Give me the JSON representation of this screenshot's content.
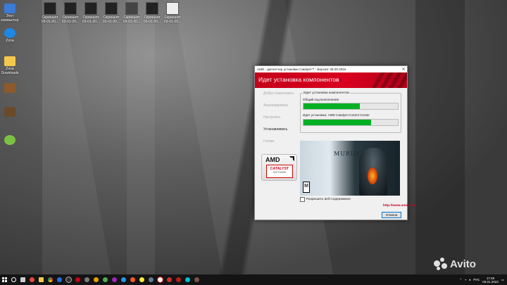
{
  "desktop": {
    "top_icons": [
      {
        "label": "Скриншот 03-01-20..."
      },
      {
        "label": "Скриншот 03-01-20..."
      },
      {
        "label": "Скриншот 03-01-20..."
      },
      {
        "label": "Скриншот 03-01-20..."
      },
      {
        "label": "Скриншот 03-01-20..."
      },
      {
        "label": "Скриншот 03-01-20..."
      },
      {
        "label": "Скриншот 03-01-20..."
      }
    ],
    "left_icons": [
      {
        "label": "Этот компьютер"
      },
      {
        "label": "Zona"
      },
      {
        "label": "Zona Downloads"
      },
      {
        "label": ""
      },
      {
        "label": ""
      },
      {
        "label": ""
      }
    ]
  },
  "installer": {
    "title": "AMD - диспетчер установки Catalyst™ - Версия: 08.00.0916",
    "banner_title": "Идет установка компонентов",
    "steps": [
      {
        "label": "Добро пожаловать",
        "active": false
      },
      {
        "label": "Анализировать",
        "active": false
      },
      {
        "label": "Настроить",
        "active": false
      },
      {
        "label": "Устанавливать",
        "active": true
      },
      {
        "label": "Готово",
        "active": false
      }
    ],
    "progress_group_title": "Идет установка компонентов",
    "overall_label": "Общий ход выполнения",
    "overall_progress": 0.6,
    "current_label": "Идет установка: AMD Catalyst Control Center",
    "current_progress": 0.72,
    "logo": {
      "amd": "AMD",
      "catalyst": "CATALYST",
      "software": "SOFTWARE"
    },
    "ad": {
      "game_title": "MURDERED",
      "rating": "M"
    },
    "web_content_label": "Разрешить веб-содержимое",
    "url": "http://www.amd.com",
    "cancel_label": "Отмена",
    "accent_color": "#d8001e",
    "progress_color": "#06b025"
  },
  "taskbar": {
    "language": "РУС",
    "time": "17:49",
    "date": "03.01.2023"
  },
  "watermark": "Avito"
}
